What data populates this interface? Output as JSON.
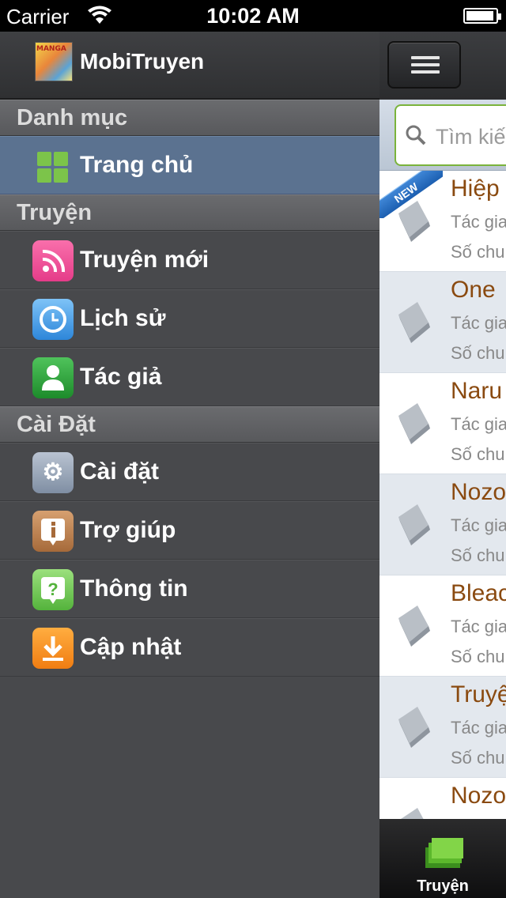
{
  "status_bar": {
    "carrier": "Carrier",
    "time": "10:02 AM"
  },
  "sidebar": {
    "app_name": "MobiTruyen",
    "logo_text": "MANGA",
    "sections": [
      {
        "title": "Danh mục",
        "items": [
          {
            "label": "Trang chủ",
            "icon": "grid-icon",
            "active": true
          }
        ]
      },
      {
        "title": "Truyện",
        "items": [
          {
            "label": "Truyện mới",
            "icon": "rss-icon"
          },
          {
            "label": "Lịch sử",
            "icon": "clock-icon"
          },
          {
            "label": "Tác giả",
            "icon": "user-icon"
          }
        ]
      },
      {
        "title": "Cài Đặt",
        "items": [
          {
            "label": "Cài đặt",
            "icon": "gear-icon"
          },
          {
            "label": "Trợ giúp",
            "icon": "info-icon"
          },
          {
            "label": "Thông tin",
            "icon": "help-icon"
          },
          {
            "label": "Cập nhật",
            "icon": "download-icon"
          }
        ]
      }
    ]
  },
  "panel": {
    "search_placeholder": "Tìm kiế",
    "new_badge": "NEW",
    "stories": [
      {
        "title": "Hiệp",
        "author": "Tác gia",
        "chapters": "Số chu"
      },
      {
        "title": "One",
        "author": "Tác gia",
        "chapters": "Số chu"
      },
      {
        "title": "Naru",
        "author": "Tác gia",
        "chapters": "Số chu"
      },
      {
        "title": "Nozo",
        "author": "Tác gia",
        "chapters": "Số chu"
      },
      {
        "title": "Bleac",
        "author": "Tác gia",
        "chapters": "Số chu"
      },
      {
        "title": "Truyệ",
        "author": "Tác gia",
        "chapters": "Số chu"
      },
      {
        "title": "Nozo",
        "author": "",
        "chapters": ""
      }
    ],
    "tab_label": "Truyện"
  },
  "colors": {
    "sidebar_bg": "#48494c",
    "active_item": "#5b7290",
    "story_title": "#8a4a10",
    "search_border": "#7ab33c"
  }
}
